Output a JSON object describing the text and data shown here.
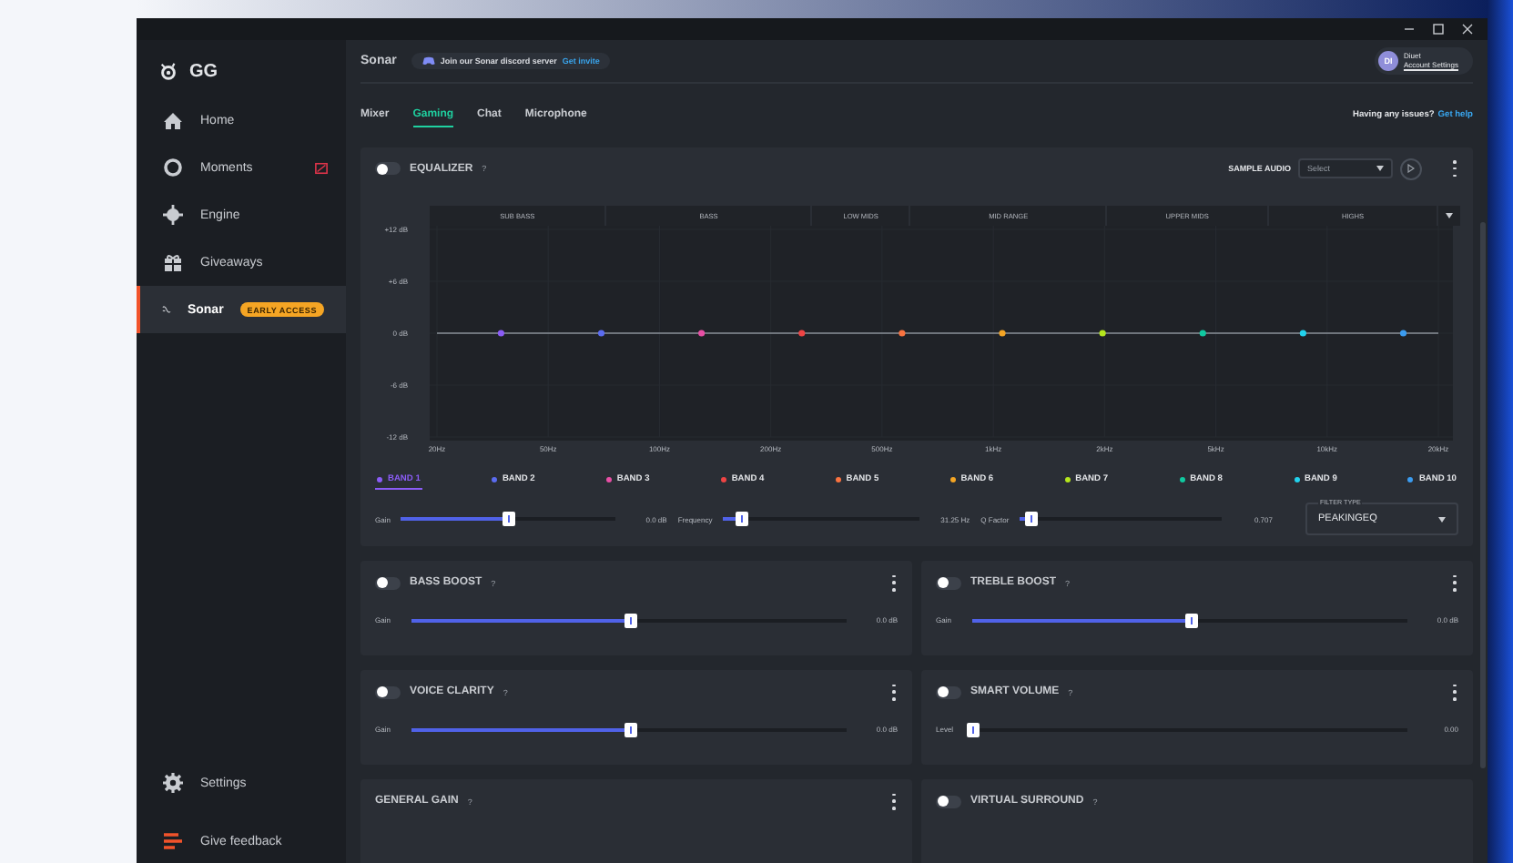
{
  "sidebar": {
    "logo": "GG",
    "items": [
      {
        "label": "Home",
        "selected": false
      },
      {
        "label": "Moments",
        "selected": false,
        "alert": true
      },
      {
        "label": "Engine",
        "selected": false
      },
      {
        "label": "Giveaways",
        "selected": false
      },
      {
        "label": "Sonar",
        "selected": true,
        "badge": "EARLY ACCESS"
      }
    ],
    "footer": [
      {
        "label": "Settings"
      },
      {
        "label": "Give feedback"
      }
    ]
  },
  "header": {
    "title": "Sonar",
    "discord": {
      "text": "Join our Sonar discord server",
      "link": "Get invite"
    },
    "account": {
      "initials": "DI",
      "name": "Diuet",
      "link": "Account Settings"
    }
  },
  "tabs": [
    {
      "label": "Mixer",
      "selected": false
    },
    {
      "label": "Gaming",
      "selected": true
    },
    {
      "label": "Chat",
      "selected": false
    },
    {
      "label": "Microphone",
      "selected": false
    }
  ],
  "help": {
    "text": "Having any issues?",
    "link": "Get help"
  },
  "equalizer": {
    "title": "EQUALIZER",
    "help": "?",
    "enabled": false,
    "sample_audio": {
      "label": "SAMPLE AUDIO",
      "placeholder": "Select"
    },
    "regions": [
      "SUB BASS",
      "BASS",
      "LOW MIDS",
      "MID RANGE",
      "UPPER MIDS",
      "HIGHS"
    ],
    "chart_data": {
      "type": "line",
      "categories": [
        null,
        null,
        null,
        null,
        null,
        null,
        null,
        null,
        null,
        null
      ],
      "series": [
        {
          "color": "#8a9099",
          "values": [
            0,
            0,
            0,
            0,
            0,
            0,
            0,
            0,
            0,
            0
          ]
        }
      ],
      "yticks": [
        {
          "value": 12,
          "label": "+12 dB"
        },
        {
          "value": 6,
          "label": "+6 dB"
        },
        {
          "value": 0,
          "label": "0 dB"
        },
        {
          "value": -6,
          "label": "-6 dB"
        },
        {
          "value": -12,
          "label": "-12 dB"
        }
      ],
      "ylim": [
        -12,
        12
      ],
      "grid": true
    },
    "frequency_labels": [
      "20Hz",
      "50Hz",
      "100Hz",
      "200Hz",
      "500Hz",
      "1kHz",
      "2kHz",
      "5kHz",
      "10kHz",
      "20kHz"
    ],
    "bands": [
      {
        "label": "BAND 1",
        "color": "#8b5cf6",
        "selected": true
      },
      {
        "label": "BAND 2",
        "color": "#5b6cf0",
        "selected": false
      },
      {
        "label": "BAND 3",
        "color": "#e84fa5",
        "selected": false
      },
      {
        "label": "BAND 4",
        "color": "#ef4444",
        "selected": false
      },
      {
        "label": "BAND 5",
        "color": "#f97340",
        "selected": false
      },
      {
        "label": "BAND 6",
        "color": "#f5a524",
        "selected": false
      },
      {
        "label": "BAND 7",
        "color": "#b5e61d",
        "selected": false
      },
      {
        "label": "BAND 8",
        "color": "#10c9a0",
        "selected": false
      },
      {
        "label": "BAND 9",
        "color": "#22d3ee",
        "selected": false
      },
      {
        "label": "BAND 10",
        "color": "#3b9cf0",
        "selected": false
      }
    ],
    "sliders": [
      {
        "label": "Gain",
        "level": 0.5,
        "reading": "0.0 dB"
      },
      {
        "label": "Frequency",
        "level": 0.09,
        "reading": "31.25 Hz"
      },
      {
        "label": "Q Factor",
        "level": 0.05,
        "reading": "0.707"
      }
    ],
    "filter_type": {
      "label": "FILTER TYPE",
      "value": "PEAKINGEQ"
    }
  },
  "cards": [
    {
      "title": "BASS BOOST",
      "help": "?",
      "enabled": false,
      "menu": true,
      "slider": {
        "label": "Gain",
        "level": 0.5,
        "reading": "0.0 dB"
      }
    },
    {
      "title": "TREBLE BOOST",
      "help": "?",
      "enabled": false,
      "menu": true,
      "slider": {
        "label": "Gain",
        "level": 0.5,
        "reading": "0.0 dB"
      }
    },
    {
      "title": "VOICE CLARITY",
      "help": "?",
      "enabled": false,
      "menu": true,
      "slider": {
        "label": "Gain",
        "level": 0.5,
        "reading": "0.0 dB"
      }
    },
    {
      "title": "SMART VOLUME",
      "help": "?",
      "enabled": false,
      "menu": true,
      "slider": {
        "label": "Level",
        "level": 0,
        "reading": "0.00"
      }
    },
    {
      "title": "GENERAL GAIN",
      "help": "?",
      "menu": true
    },
    {
      "title": "VIRTUAL SURROUND",
      "help": "?",
      "enabled": false,
      "menu": false
    }
  ]
}
